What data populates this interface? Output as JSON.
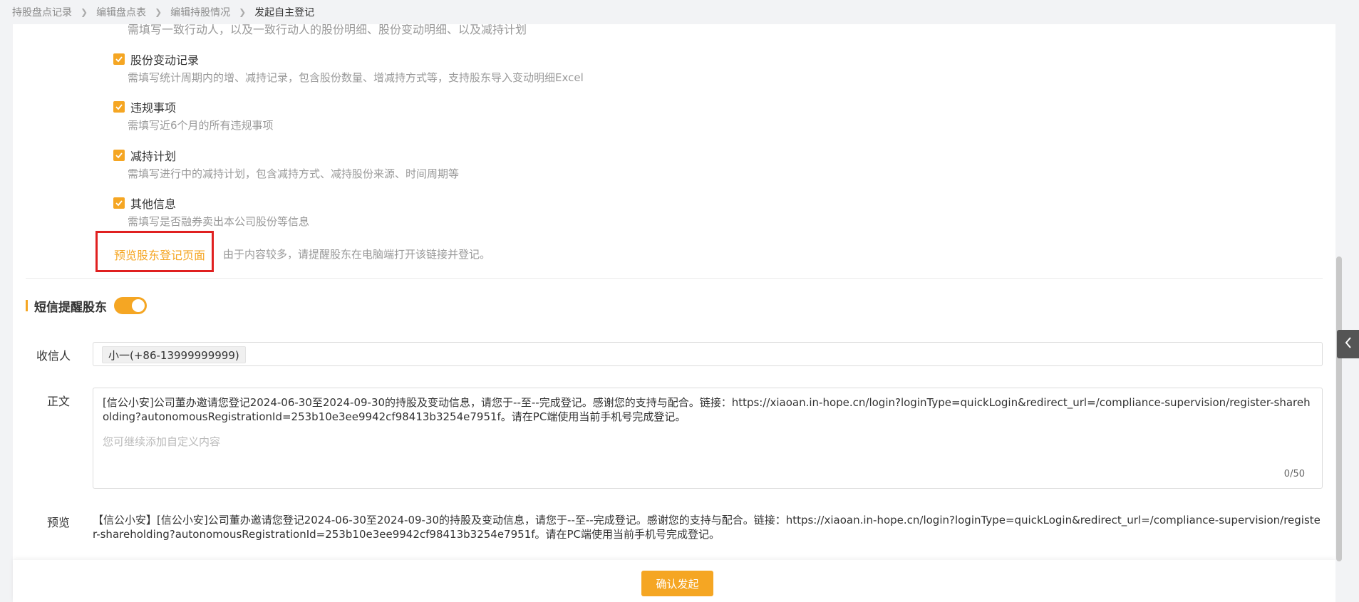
{
  "breadcrumb": {
    "items": [
      "持股盘点记录",
      "编辑盘点表",
      "编辑持股情况",
      "发起自主登记"
    ]
  },
  "top_cut_text": "需填写一致行动人，以及一致行动人的股份明细、股份变动明细、以及减持计划",
  "options": [
    {
      "title": "股份变动记录",
      "desc": "需填写统计周期内的增、减持记录，包含股份数量、增减持方式等，支持股东导入变动明细Excel",
      "checked": true
    },
    {
      "title": "违规事项",
      "desc": "需填写近6个月的所有违规事项",
      "checked": true
    },
    {
      "title": "减持计划",
      "desc": "需填写进行中的减持计划，包含减持方式、减持股份来源、时间周期等",
      "checked": true
    },
    {
      "title": "其他信息",
      "desc": "需填写是否融券卖出本公司股份等信息",
      "checked": true
    }
  ],
  "preview": {
    "link_label": "预览股东登记页面",
    "hint": "由于内容较多，请提醒股东在电脑端打开该链接并登记。"
  },
  "sms": {
    "title": "短信提醒股东",
    "enabled": true,
    "recipient_label": "收信人",
    "recipient_tag": "小一(+86-13999999999)",
    "body_label": "正文",
    "body_text": "[信公小安]公司董办邀请您登记2024-06-30至2024-09-30的持股及变动信息，请您于--至--完成登记。感谢您的支持与配合。链接：https://xiaoan.in-hope.cn/login?loginType=quickLogin&redirect_url=/compliance-supervision/register-shareholding?autonomousRegistrationId=253b10e3ee9942cf98413b3254e7951f。请在PC端使用当前手机号完成登记。",
    "custom_placeholder": "您可继续添加自定义内容",
    "counter": "0/50",
    "preview_label": "预览",
    "preview_text": "【信公小安】[信公小安]公司董办邀请您登记2024-06-30至2024-09-30的持股及变动信息，请您于--至--完成登记。感谢您的支持与配合。链接：https://xiaoan.in-hope.cn/login?loginType=quickLogin&redirect_url=/compliance-supervision/register-shareholding?autonomousRegistrationId=253b10e3ee9942cf98413b3254e7951f。请在PC端使用当前手机号完成登记。"
  },
  "footer": {
    "confirm_label": "确认发起"
  },
  "colors": {
    "accent": "#f5a623",
    "highlight_box": "#e02020"
  }
}
